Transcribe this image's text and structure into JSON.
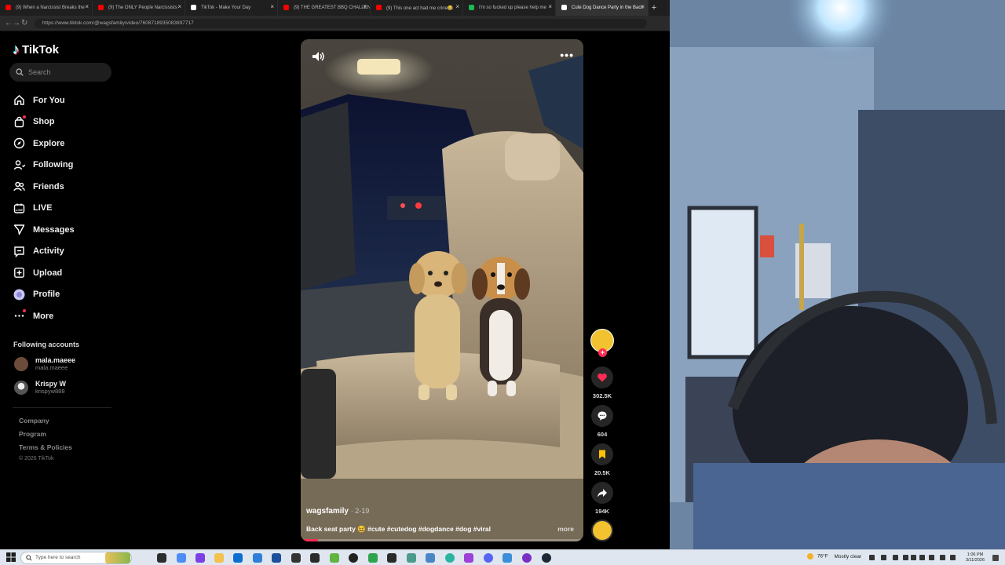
{
  "browser": {
    "tabs": [
      {
        "title": "(9) When a Narcissist Breaks the",
        "favicon_color": "#ff0000",
        "active": false
      },
      {
        "title": "(9) The ONLY People Narcissists",
        "favicon_color": "#ff0000",
        "active": false
      },
      {
        "title": "TikTok - Make Your Day",
        "favicon_color": "#ffffff",
        "active": false
      },
      {
        "title": "(9) THE GREATEST BBQ CHALLENGE",
        "favicon_color": "#ff0000",
        "active": false
      },
      {
        "title": "(9) This one act had me crine😂",
        "favicon_color": "#ff0000",
        "active": false
      },
      {
        "title": "I'm so fucked up please help me",
        "favicon_color": "#1db954",
        "active": false
      },
      {
        "title": "Cute Dog Dance Party in the Back",
        "favicon_color": "#ffffff",
        "active": true
      }
    ],
    "url": "https://www.tiktok.com/@wagsfamily/video/7608718935083897717"
  },
  "sidebar": {
    "logo_text": "TikTok",
    "search_placeholder": "Search",
    "nav": [
      {
        "label": "For You",
        "icon": "home-icon"
      },
      {
        "label": "Shop",
        "icon": "shopping-bag-icon",
        "dot": true
      },
      {
        "label": "Explore",
        "icon": "compass-icon"
      },
      {
        "label": "Following",
        "icon": "user-follow-icon"
      },
      {
        "label": "Friends",
        "icon": "friends-icon"
      },
      {
        "label": "LIVE",
        "icon": "live-icon"
      },
      {
        "label": "Messages",
        "icon": "send-icon"
      },
      {
        "label": "Activity",
        "icon": "activity-icon"
      },
      {
        "label": "Upload",
        "icon": "upload-icon"
      },
      {
        "label": "Profile",
        "icon": "avatar-icon"
      },
      {
        "label": "More",
        "icon": "more-icon",
        "dot": true
      }
    ],
    "following_heading": "Following accounts",
    "accounts": [
      {
        "name": "mala.maeee",
        "handle": "mala.maeee"
      },
      {
        "name": "Krispy W",
        "handle": "krispyw888"
      }
    ],
    "footer_links": [
      "Company",
      "Program",
      "Terms & Policies"
    ],
    "copyright": "© 2026 TikTok"
  },
  "video": {
    "username": "wagsfamily",
    "date": "· 2-19",
    "caption": "Back seat party 😆 #cute #cutedog #dogdance #dog #viral",
    "more_label": "more",
    "progress_percent": 6
  },
  "actions": {
    "likes": "302.5K",
    "comments": "604",
    "saves": "20.5K",
    "shares": "194K",
    "like_color": "#fe2c55",
    "save_color": "#ffc300"
  },
  "taskbar": {
    "search_placeholder": "Type here to search",
    "weather_temp": "76°F",
    "weather_condition": "Mostly clear",
    "time": "1:06 PM",
    "date": "3/11/2026"
  }
}
